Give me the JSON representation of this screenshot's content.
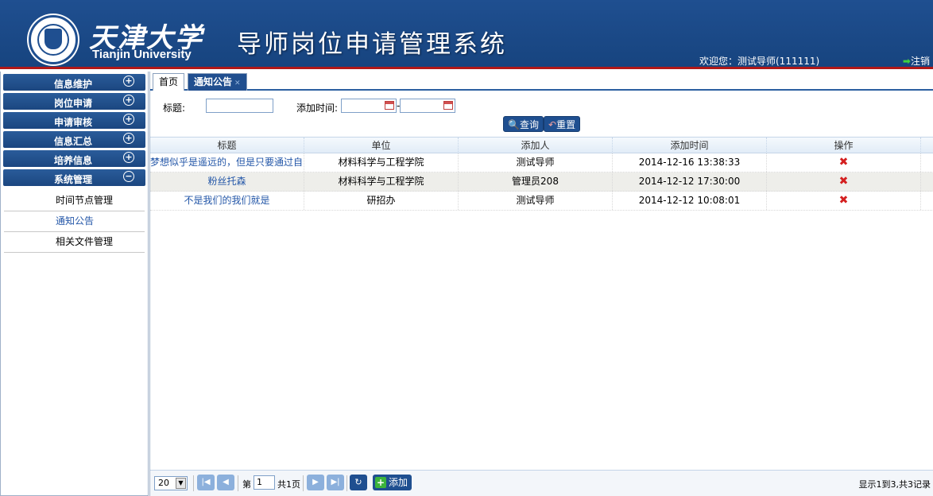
{
  "header": {
    "logo_cn": "天津大学",
    "logo_en": "Tianjin University",
    "system_title": "导师岗位申请管理系统",
    "welcome_text": "欢迎您：测试导师(111111)",
    "logout_label": "注销"
  },
  "sidebar": {
    "menus": [
      {
        "label": "信息维护",
        "toggle": "⊕"
      },
      {
        "label": "岗位申请",
        "toggle": "⊕"
      },
      {
        "label": "申请审核",
        "toggle": "⊕"
      },
      {
        "label": "信息汇总",
        "toggle": "⊕"
      },
      {
        "label": "培养信息",
        "toggle": "⊕"
      },
      {
        "label": "系统管理",
        "toggle": "⊖"
      }
    ],
    "subitems": [
      {
        "label": "时间节点管理"
      },
      {
        "label": "通知公告"
      },
      {
        "label": "相关文件管理"
      }
    ]
  },
  "tabs": {
    "home": "首页",
    "notice": "通知公告"
  },
  "search": {
    "title_label": "标题:",
    "title_value": "",
    "time_label": "添加时间:",
    "date_from": "",
    "date_to": "",
    "dash": "-",
    "query_label": "查询",
    "reset_label": "重置"
  },
  "table": {
    "columns": [
      "标题",
      "单位",
      "添加人",
      "添加时间",
      "操作"
    ],
    "rows": [
      {
        "title": "梦想似乎是遥远的，但是只要通过自己的",
        "unit": "材料科学与工程学院",
        "adder": "测试导师",
        "time": "2014-12-16 13:38:33"
      },
      {
        "title": "粉丝托森",
        "unit": "材料科学与工程学院",
        "adder": "管理员208",
        "time": "2014-12-12 17:30:00"
      },
      {
        "title": "不是我们的我们就是",
        "unit": "研招办",
        "adder": "测试导师",
        "time": "2014-12-12 10:08:01"
      }
    ]
  },
  "pager": {
    "page_size": "20",
    "page_prefix": "第",
    "page_value": "1",
    "page_suffix": "共1页",
    "add_label": "添加",
    "info": "显示1到3,共3记录"
  },
  "colors": {
    "header_bg": "#1f4f90",
    "accent_red": "#b01818",
    "link_blue": "#2457a8"
  }
}
